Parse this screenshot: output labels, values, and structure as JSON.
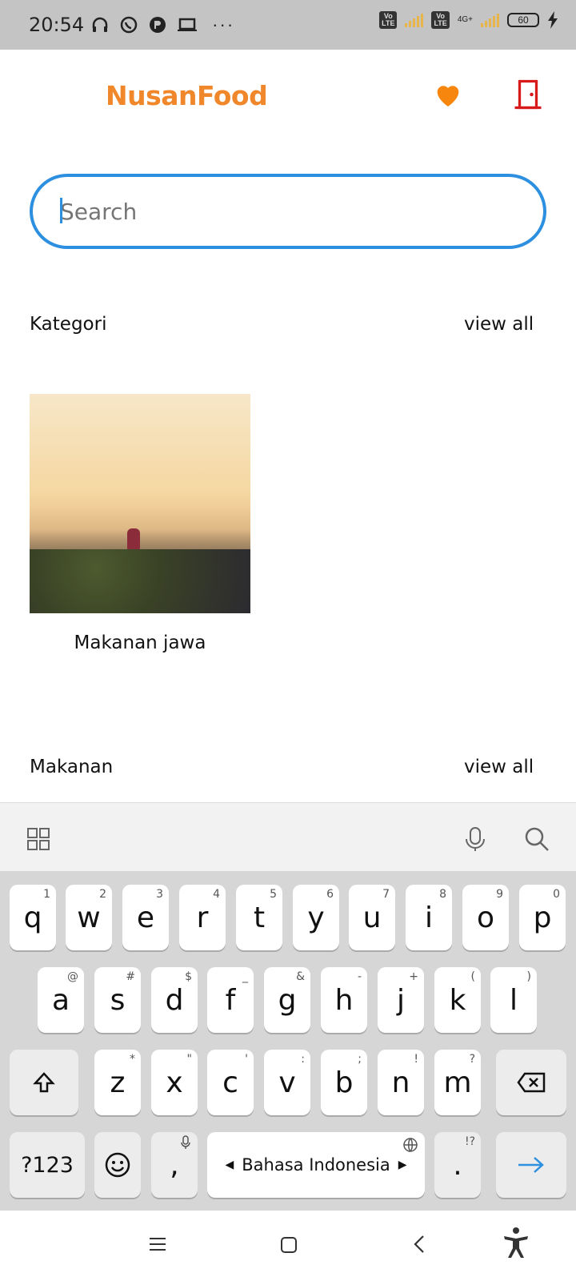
{
  "status": {
    "time": "20:54",
    "network_label": "4G+",
    "battery": "60"
  },
  "app": {
    "brand": "NusanFood"
  },
  "search": {
    "placeholder": "Search"
  },
  "sections": {
    "kategori": {
      "title": "Kategori",
      "view_all": "view all"
    },
    "makanan": {
      "title": "Makanan",
      "view_all": "view all"
    }
  },
  "categories": [
    {
      "label": "Makanan jawa"
    }
  ],
  "keyboard": {
    "row1": [
      {
        "k": "q",
        "h": "1"
      },
      {
        "k": "w",
        "h": "2"
      },
      {
        "k": "e",
        "h": "3"
      },
      {
        "k": "r",
        "h": "4"
      },
      {
        "k": "t",
        "h": "5"
      },
      {
        "k": "y",
        "h": "6"
      },
      {
        "k": "u",
        "h": "7"
      },
      {
        "k": "i",
        "h": "8"
      },
      {
        "k": "o",
        "h": "9"
      },
      {
        "k": "p",
        "h": "0"
      }
    ],
    "row2": [
      {
        "k": "a",
        "h": "@"
      },
      {
        "k": "s",
        "h": "#"
      },
      {
        "k": "d",
        "h": "$"
      },
      {
        "k": "f",
        "h": "_"
      },
      {
        "k": "g",
        "h": "&"
      },
      {
        "k": "h",
        "h": "-"
      },
      {
        "k": "j",
        "h": "+"
      },
      {
        "k": "k",
        "h": "("
      },
      {
        "k": "l",
        "h": ")"
      }
    ],
    "row3": [
      {
        "k": "z",
        "h": "*"
      },
      {
        "k": "x",
        "h": "\""
      },
      {
        "k": "c",
        "h": "'"
      },
      {
        "k": "v",
        "h": ":"
      },
      {
        "k": "b",
        "h": ";"
      },
      {
        "k": "n",
        "h": "!"
      },
      {
        "k": "m",
        "h": "?"
      }
    ],
    "symbols_label": "?123",
    "comma_label": ",",
    "space_label": "Bahasa Indonesia",
    "period_label": ".",
    "period_hint": "!?"
  },
  "icons": {
    "favorite": "heart-icon",
    "logout": "door-icon",
    "accent": "#f0872a",
    "logout_color": "#d91a1a",
    "search_border": "#2d8fe0"
  }
}
